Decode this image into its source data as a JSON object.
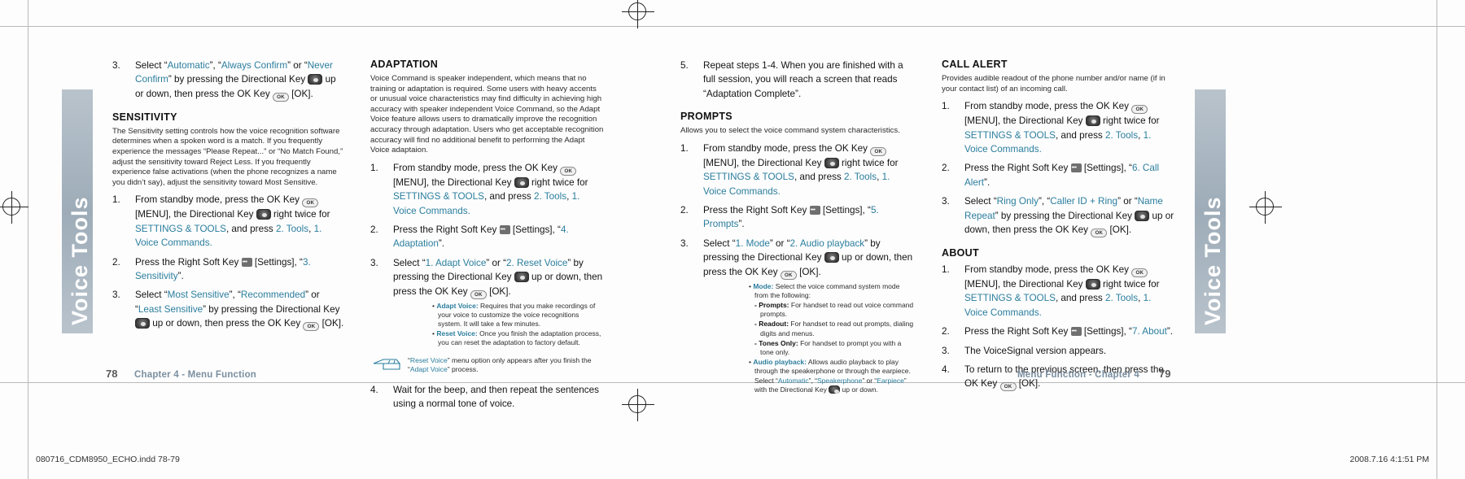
{
  "sidetabs": {
    "left_label": "Voice Tools",
    "right_label": "Voice Tools"
  },
  "col1": {
    "step3": {
      "num": "3.",
      "seg1": "Select “",
      "opt1": "Automatic",
      "seg2": "”, “",
      "opt2": "Always Confirm",
      "seg3": "” or “",
      "opt3": "Never Confirm",
      "seg4": "” by pressing the Directional Key ",
      "seg5": " up or down, then press the OK Key ",
      "seg6": " [OK]."
    },
    "sensitivity_heading": "SENSITIVITY",
    "sensitivity_body": "The Sensitivity setting controls how the voice recognition software determines when a spoken word is a match. If you frequently experience the messages “Please Repeat...” or “No Match Found,” adjust the sensitivity toward Reject Less. If you frequently experience false activations (when the phone recognizes a name you didn’t say), adjust the sensitivity toward Most Sensitive.",
    "step1": {
      "num": "1.",
      "a": "From standby mode, press the OK Key ",
      "b": " [MENU], the Directional Key ",
      "c": " right twice for ",
      "settings": "SETTINGS & TOOLS",
      "d": ", and press ",
      "tools": "2. Tools",
      "e": ",",
      "voice": "1. Voice Commands",
      "f": "."
    },
    "step2": {
      "num": "2.",
      "a": "Press the Right Soft Key ",
      "b": " [Settings], “",
      "item": "3. Sensitivity",
      "c": "”."
    },
    "step3b": {
      "num": "3.",
      "a": "Select “",
      "opt1": "Most Sensitive",
      "b": "”, “",
      "opt2": "Recommended",
      "c": "” or “",
      "opt3": "Least Sensitive",
      "d": "” by pressing the Directional Key ",
      "e": " up or down, then press the OK Key ",
      "f": " [OK]."
    }
  },
  "col2": {
    "adaptation_heading": "ADAPTATION",
    "adaptation_body": "Voice Command is speaker independent, which means that no training or adaptation is required. Some users with heavy accents or unusual voice characteristics may find difficulty in achieving high accuracy with speaker independent Voice Command, so the Adapt Voice feature allows users to dramatically improve the recognition accuracy through adaptation. Users who get acceptable recognition accuracy will find no additional benefit to performing the Adapt Voice adaptaion.",
    "step1": {
      "num": "1.",
      "a": "From standby mode, press the OK Key ",
      "b": " [MENU], the Directional Key ",
      "c": " right twice for ",
      "settings": "SETTINGS & TOOLS",
      "d": ", and press ",
      "tools": "2. Tools",
      "e": ",",
      "voice": "1. Voice Commands",
      "f": "."
    },
    "step2": {
      "num": "2.",
      "a": "Press the Right Soft Key ",
      "b": " [Settings], “",
      "item": "4. Adaptation",
      "c": "”."
    },
    "step3": {
      "num": "3.",
      "a": "Select “",
      "opt1": "1. Adapt Voice",
      "b": "” or “",
      "opt2": "2. Reset Voice",
      "c": "” by pressing the Directional Key ",
      "d": " up or down, then press the OK Key ",
      "e": " [OK]."
    },
    "bullets": [
      {
        "label": "Adapt Voice:",
        "text": "Requires that you make recordings of your voice to customize the voice recognitions system. It will take a few minutes."
      },
      {
        "label": "Reset Voice:",
        "text": "Once you finish the adaptation process, you can reset the adaptation to factory default."
      }
    ],
    "callout": {
      "a": "“",
      "b": "Reset Voice",
      "c": "” menu option only appears after you finish the “",
      "d": "Adapt Voice",
      "e": "” process."
    },
    "step4": {
      "num": "4.",
      "text": "Wait for the beep, and then repeat the sentences using a normal tone of voice."
    }
  },
  "col3": {
    "step5": {
      "num": "5.",
      "text": "Repeat steps 1-4. When you are finished with a full session, you will reach a screen that reads “Adaptation Complete”."
    },
    "prompts_heading": "PROMPTS",
    "prompts_body": "Allows you to select the voice command system characteristics.",
    "step1": {
      "num": "1.",
      "a": "From standby mode, press the OK Key ",
      "b": " [MENU], the Directional Key ",
      "c": " right twice for ",
      "settings": "SETTINGS & TOOLS",
      "d": ", and press ",
      "tools": "2. Tools",
      "e": ",",
      "voice": "1. Voice Commands",
      "f": "."
    },
    "step2": {
      "num": "2.",
      "a": "Press the Right Soft Key ",
      "b": " [Settings], “",
      "item": "5. Prompts",
      "c": "”."
    },
    "step3": {
      "num": "3.",
      "a": "Select “",
      "opt1": "1. Mode",
      "b": "” or “",
      "opt2": "2. Audio playback",
      "c": "” by pressing the Directional Key ",
      "d": " up or down, then press the OK Key ",
      "e": " [OK]."
    },
    "mode_bullet_label": "Mode:",
    "mode_bullet_text": "Select the voice command system mode from the following:",
    "mode_subs": [
      {
        "label": "- Prompts:",
        "text": "For handset to read out voice command prompts."
      },
      {
        "label": "- Readout:",
        "text": "For handset to read out prompts, dialing digits and menus."
      },
      {
        "label": "- Tones Only:",
        "text": "For handset to prompt you with a tone only."
      }
    ],
    "audio_bullet_label": "Audio playback:",
    "audio_bullet_a": "Allows audio playback to play through the speakerphone or through the earpiece. Select “",
    "audio_opt1": "Automatic",
    "audio_bullet_b": "”, “",
    "audio_opt2": "Speakerphone",
    "audio_bullet_c": "” or “",
    "audio_opt3": "Earpiece",
    "audio_bullet_d": "” with the Directional Key ",
    "audio_bullet_e": " up or down."
  },
  "col4": {
    "callalert_heading": "CALL ALERT",
    "callalert_body": "Provides audible readout of the phone number and/or name (if in your contact list) of an incoming call.",
    "step1": {
      "num": "1.",
      "a": "From standby mode, press the OK Key ",
      "b": " [MENU], the Directional Key ",
      "c": " right twice for ",
      "settings": "SETTINGS & TOOLS",
      "d": ", and press ",
      "tools": "2. Tools",
      "e": ",",
      "voice": "1. Voice Commands",
      "f": "."
    },
    "step2": {
      "num": "2.",
      "a": "Press the Right Soft Key ",
      "b": " [Settings], “",
      "item": "6. Call Alert",
      "c": "”."
    },
    "step3": {
      "num": "3.",
      "a": "Select “",
      "opt1": "Ring Only",
      "b": "”, “",
      "opt2": "Caller ID + Ring",
      "c": "” or “",
      "opt3": "Name Repeat",
      "d": "” by pressing the Directional Key ",
      "e": " up or down, then press the OK Key ",
      "f": " [OK]."
    },
    "about_heading": "ABOUT",
    "about_step1": {
      "num": "1.",
      "a": "From standby mode, press the OK Key ",
      "b": " [MENU], the Directional Key ",
      "c": " right twice for ",
      "settings": "SETTINGS & TOOLS",
      "d": ", and press ",
      "tools": "2. Tools",
      "e": ",",
      "voice": "1. Voice Commands",
      "f": "."
    },
    "about_step2": {
      "num": "2.",
      "a": "Press the Right Soft Key ",
      "b": " [Settings], “",
      "item": "7. About",
      "c": "”."
    },
    "about_step3": {
      "num": "3.",
      "text": "The VoiceSignal version appears."
    },
    "about_step4": {
      "num": "4.",
      "a": "To return to the previous screen, then press the OK Key ",
      "b": " [OK]."
    }
  },
  "footer": {
    "page_left": "78",
    "chapter_left": "Chapter 4 - Menu Function",
    "chapter_right": "Menu Function - Chapter 4",
    "page_right": "79",
    "printmark_left": "080716_CDM8950_ECHO.indd   78-79",
    "printmark_right": "2008.7.16   4:1:51 PM"
  }
}
